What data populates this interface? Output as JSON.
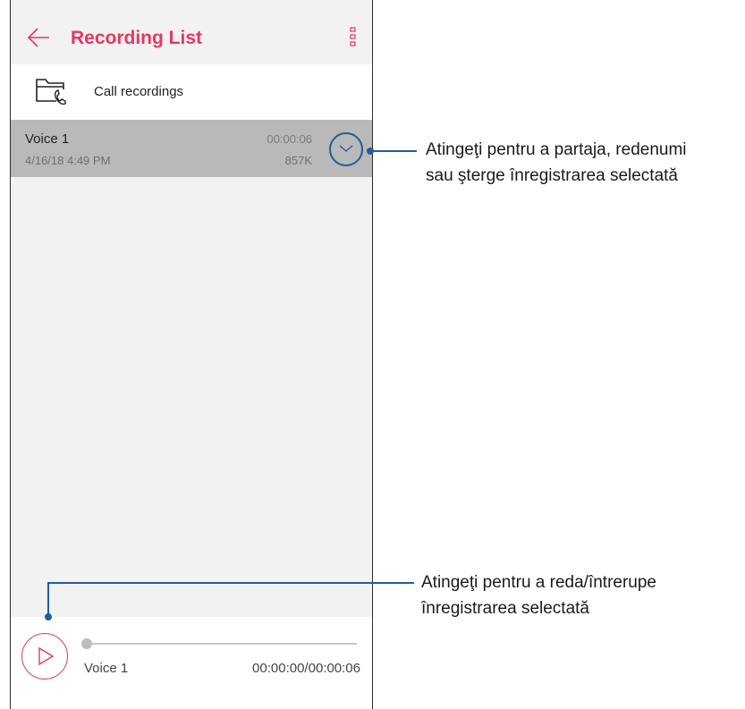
{
  "colors": {
    "accent": "#e8365f",
    "callout": "#1d5f9d",
    "selected_row": "#b9b9b9",
    "background": "#f2f2f2"
  },
  "appbar": {
    "back_icon": "arrow-left-icon",
    "title": "Recording List",
    "more_icon": "more-vertical-icon"
  },
  "call_recordings": {
    "icon": "folder-phone-icon",
    "label": "Call recordings"
  },
  "recordings": [
    {
      "name": "Voice 1",
      "date": "4/16/18 4:49 PM",
      "duration": "00:00:06",
      "size": "857K",
      "selected": true
    }
  ],
  "player": {
    "play_icon": "play-icon",
    "name": "Voice 1",
    "time": "00:00:00/00:00:06",
    "progress": 0
  },
  "callouts": {
    "expand": {
      "line1": "Atingeţi pentru a partaja, redenumi",
      "line2": "sau şterge înregistrarea selectată"
    },
    "play": {
      "line1": "Atingeţi pentru a reda/întrerupe",
      "line2": "înregistrarea selectată"
    }
  }
}
